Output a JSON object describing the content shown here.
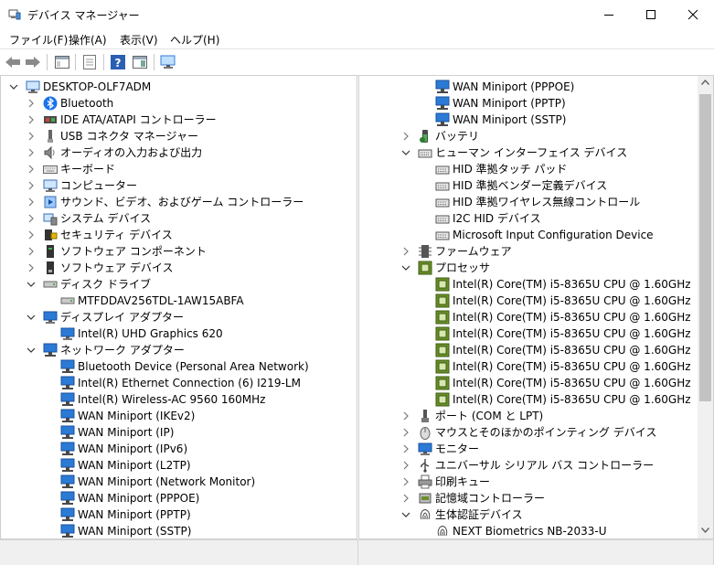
{
  "window": {
    "title": "デバイス マネージャー"
  },
  "menu": [
    "ファイル(F)",
    "操作(A)",
    "表示(V)",
    "ヘルプ(H)"
  ],
  "left_tree": [
    {
      "depth": 0,
      "exp": "open",
      "icon": "computer-icon",
      "label": "DESKTOP-OLF7ADM"
    },
    {
      "depth": 1,
      "exp": "closed",
      "icon": "bluetooth-icon",
      "label": "Bluetooth"
    },
    {
      "depth": 1,
      "exp": "closed",
      "icon": "ide-controller-icon",
      "label": "IDE ATA/ATAPI コントローラー"
    },
    {
      "depth": 1,
      "exp": "closed",
      "icon": "usb-connector-icon",
      "label": "USB コネクタ マネージャー"
    },
    {
      "depth": 1,
      "exp": "closed",
      "icon": "audio-icon",
      "label": "オーディオの入力および出力"
    },
    {
      "depth": 1,
      "exp": "closed",
      "icon": "keyboard-icon",
      "label": "キーボード"
    },
    {
      "depth": 1,
      "exp": "closed",
      "icon": "computer-icon",
      "label": "コンピューター"
    },
    {
      "depth": 1,
      "exp": "closed",
      "icon": "sound-video-icon",
      "label": "サウンド、ビデオ、およびゲーム コントローラー"
    },
    {
      "depth": 1,
      "exp": "closed",
      "icon": "system-device-icon",
      "label": "システム デバイス"
    },
    {
      "depth": 1,
      "exp": "closed",
      "icon": "security-device-icon",
      "label": "セキュリティ デバイス"
    },
    {
      "depth": 1,
      "exp": "closed",
      "icon": "software-component-icon",
      "label": "ソフトウェア コンポーネント"
    },
    {
      "depth": 1,
      "exp": "closed",
      "icon": "software-device-icon",
      "label": "ソフトウェア デバイス"
    },
    {
      "depth": 1,
      "exp": "open",
      "icon": "disk-drive-icon",
      "label": "ディスク ドライブ"
    },
    {
      "depth": 2,
      "exp": "none",
      "icon": "disk-drive-icon",
      "label": "MTFDDAV256TDL-1AW15ABFA"
    },
    {
      "depth": 1,
      "exp": "open",
      "icon": "display-adapter-icon",
      "label": "ディスプレイ アダプター"
    },
    {
      "depth": 2,
      "exp": "none",
      "icon": "display-adapter-icon",
      "label": "Intel(R) UHD Graphics 620"
    },
    {
      "depth": 1,
      "exp": "open",
      "icon": "network-adapter-icon",
      "label": "ネットワーク アダプター"
    },
    {
      "depth": 2,
      "exp": "none",
      "icon": "network-adapter-icon",
      "label": "Bluetooth Device (Personal Area Network)"
    },
    {
      "depth": 2,
      "exp": "none",
      "icon": "network-adapter-icon",
      "label": "Intel(R) Ethernet Connection (6) I219-LM"
    },
    {
      "depth": 2,
      "exp": "none",
      "icon": "network-adapter-icon",
      "label": "Intel(R) Wireless-AC 9560 160MHz"
    },
    {
      "depth": 2,
      "exp": "none",
      "icon": "network-adapter-icon",
      "label": "WAN Miniport (IKEv2)"
    },
    {
      "depth": 2,
      "exp": "none",
      "icon": "network-adapter-icon",
      "label": "WAN Miniport (IP)"
    },
    {
      "depth": 2,
      "exp": "none",
      "icon": "network-adapter-icon",
      "label": "WAN Miniport (IPv6)"
    },
    {
      "depth": 2,
      "exp": "none",
      "icon": "network-adapter-icon",
      "label": "WAN Miniport (L2TP)"
    },
    {
      "depth": 2,
      "exp": "none",
      "icon": "network-adapter-icon",
      "label": "WAN Miniport (Network Monitor)"
    },
    {
      "depth": 2,
      "exp": "none",
      "icon": "network-adapter-icon",
      "label": "WAN Miniport (PPPOE)"
    },
    {
      "depth": 2,
      "exp": "none",
      "icon": "network-adapter-icon",
      "label": "WAN Miniport (PPTP)"
    },
    {
      "depth": 2,
      "exp": "none",
      "icon": "network-adapter-icon",
      "label": "WAN Miniport (SSTP)"
    }
  ],
  "right_tree": [
    {
      "depth": 2,
      "exp": "none",
      "icon": "network-adapter-icon",
      "label": "WAN Miniport (PPPOE)"
    },
    {
      "depth": 2,
      "exp": "none",
      "icon": "network-adapter-icon",
      "label": "WAN Miniport (PPTP)"
    },
    {
      "depth": 2,
      "exp": "none",
      "icon": "network-adapter-icon",
      "label": "WAN Miniport (SSTP)"
    },
    {
      "depth": 1,
      "exp": "closed",
      "icon": "battery-icon",
      "label": "バッテリ"
    },
    {
      "depth": 1,
      "exp": "open",
      "icon": "hid-icon",
      "label": "ヒューマン インターフェイス デバイス"
    },
    {
      "depth": 2,
      "exp": "none",
      "icon": "hid-icon",
      "label": "HID 準拠タッチ パッド"
    },
    {
      "depth": 2,
      "exp": "none",
      "icon": "hid-icon",
      "label": "HID 準拠ベンダー定義デバイス"
    },
    {
      "depth": 2,
      "exp": "none",
      "icon": "hid-icon",
      "label": "HID 準拠ワイヤレス無線コントロール"
    },
    {
      "depth": 2,
      "exp": "none",
      "icon": "hid-icon",
      "label": "I2C HID デバイス"
    },
    {
      "depth": 2,
      "exp": "none",
      "icon": "hid-icon",
      "label": "Microsoft Input Configuration Device"
    },
    {
      "depth": 1,
      "exp": "closed",
      "icon": "firmware-icon",
      "label": "ファームウェア"
    },
    {
      "depth": 1,
      "exp": "open",
      "icon": "processor-icon",
      "label": "プロセッサ"
    },
    {
      "depth": 2,
      "exp": "none",
      "icon": "processor-icon",
      "label": "Intel(R) Core(TM) i5-8365U CPU @ 1.60GHz"
    },
    {
      "depth": 2,
      "exp": "none",
      "icon": "processor-icon",
      "label": "Intel(R) Core(TM) i5-8365U CPU @ 1.60GHz"
    },
    {
      "depth": 2,
      "exp": "none",
      "icon": "processor-icon",
      "label": "Intel(R) Core(TM) i5-8365U CPU @ 1.60GHz"
    },
    {
      "depth": 2,
      "exp": "none",
      "icon": "processor-icon",
      "label": "Intel(R) Core(TM) i5-8365U CPU @ 1.60GHz"
    },
    {
      "depth": 2,
      "exp": "none",
      "icon": "processor-icon",
      "label": "Intel(R) Core(TM) i5-8365U CPU @ 1.60GHz"
    },
    {
      "depth": 2,
      "exp": "none",
      "icon": "processor-icon",
      "label": "Intel(R) Core(TM) i5-8365U CPU @ 1.60GHz"
    },
    {
      "depth": 2,
      "exp": "none",
      "icon": "processor-icon",
      "label": "Intel(R) Core(TM) i5-8365U CPU @ 1.60GHz"
    },
    {
      "depth": 2,
      "exp": "none",
      "icon": "processor-icon",
      "label": "Intel(R) Core(TM) i5-8365U CPU @ 1.60GHz"
    },
    {
      "depth": 1,
      "exp": "closed",
      "icon": "port-icon",
      "label": "ポート (COM と LPT)"
    },
    {
      "depth": 1,
      "exp": "closed",
      "icon": "mouse-icon",
      "label": "マウスとそのほかのポインティング デバイス"
    },
    {
      "depth": 1,
      "exp": "closed",
      "icon": "monitor-icon",
      "label": "モニター"
    },
    {
      "depth": 1,
      "exp": "closed",
      "icon": "usb-controller-icon",
      "label": "ユニバーサル シリアル バス コントローラー"
    },
    {
      "depth": 1,
      "exp": "closed",
      "icon": "print-queue-icon",
      "label": "印刷キュー"
    },
    {
      "depth": 1,
      "exp": "closed",
      "icon": "storage-controller-icon",
      "label": "記憶域コントローラー"
    },
    {
      "depth": 1,
      "exp": "open",
      "icon": "biometric-icon",
      "label": "生体認証デバイス"
    },
    {
      "depth": 2,
      "exp": "none",
      "icon": "biometric-icon",
      "label": "NEXT Biometrics NB-2033-U"
    }
  ],
  "right_scroll": {
    "thumb_fraction": 0.72
  }
}
